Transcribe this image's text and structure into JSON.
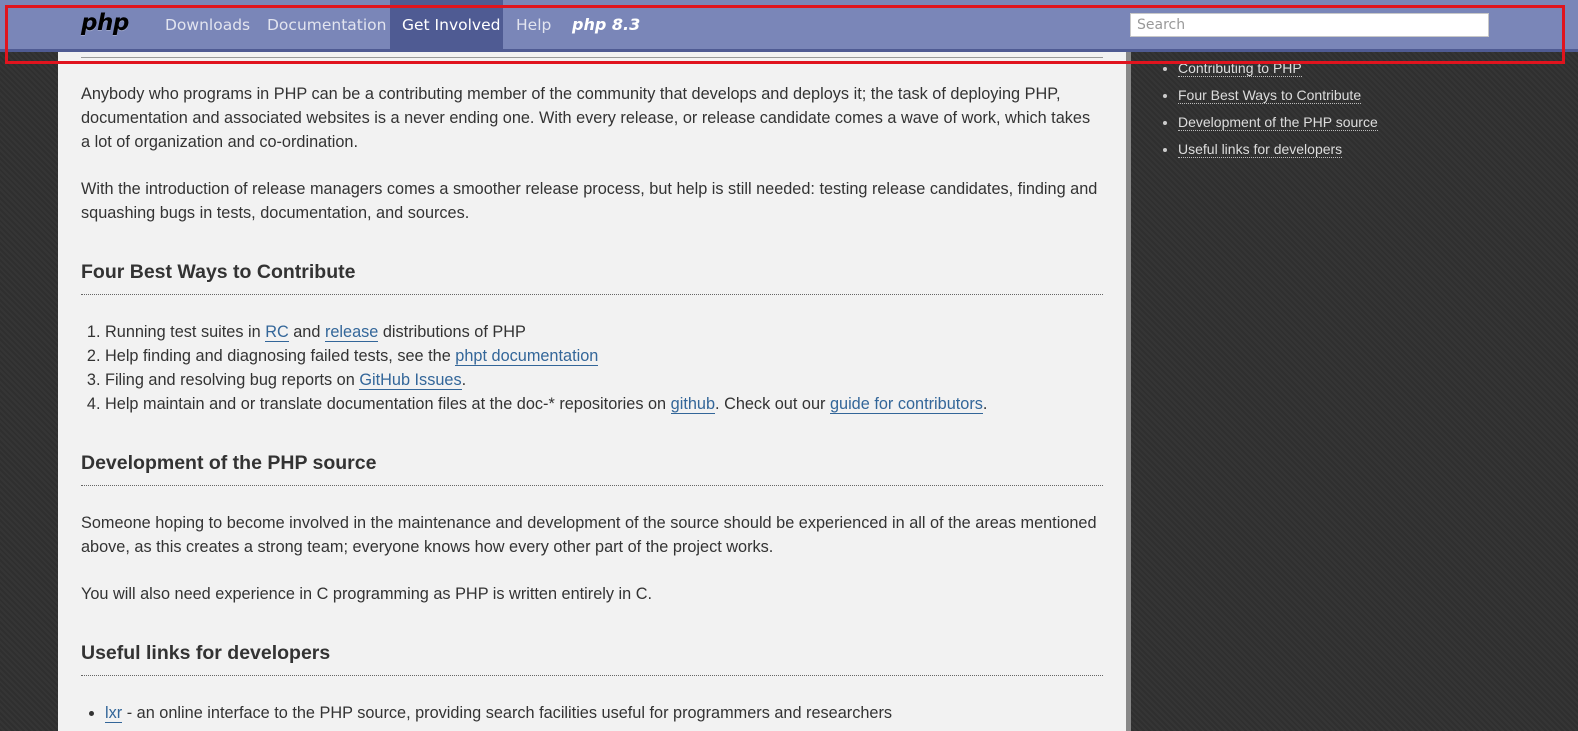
{
  "navbar": {
    "logo": "php",
    "items": [
      "Downloads",
      "Documentation",
      "Get Involved",
      "Help"
    ],
    "active_item": "Get Involved",
    "release_badge": "php 8.3",
    "search_placeholder": "Search"
  },
  "main": {
    "intro_paragraphs": [
      "Anybody who programs in PHP can be a contributing member of the community that develops and deploys it; the task of deploying PHP, documentation and associated websites is a never ending one. With every release, or release candidate comes a wave of work, which takes a lot of organization and co-ordination.",
      "With the introduction of release managers comes a smoother release process, but help is still needed: testing release candidates, finding and squashing bugs in tests, documentation, and sources."
    ],
    "sections": [
      {
        "heading": "Four Best Ways to Contribute",
        "list": [
          {
            "text_before": "Running test suites in ",
            "link1": "RC",
            "text_middle": " and ",
            "link2": "release",
            "text_after": " distributions of PHP"
          },
          {
            "text_before": "Help finding and diagnosing failed tests, see the ",
            "link1": "phpt documentation",
            "text_after": ""
          },
          {
            "text_before": "Filing and resolving bug reports on ",
            "link1": "GitHub Issues",
            "text_after": "."
          },
          {
            "text_before": "Help maintain and or translate documentation files at the doc-* repositories on ",
            "link1": "github",
            "text_middle": ". Check out our ",
            "link2": "guide for contributors",
            "text_after": "."
          }
        ]
      },
      {
        "heading": "Development of the PHP source",
        "paragraphs": [
          "Someone hoping to become involved in the maintenance and development of the source should be experienced in all of the areas mentioned above, as this creates a strong team; everyone knows how every other part of the project works.",
          "You will also need experience in C programming as PHP is written entirely in C."
        ]
      },
      {
        "heading": "Useful links for developers",
        "list": [
          {
            "link": "lxr",
            "text": " - an online interface to the PHP source, providing search facilities useful for programmers and researchers"
          }
        ]
      }
    ]
  },
  "sidebar": {
    "items": [
      "Contributing to PHP",
      "Four Best Ways to Contribute",
      "Development of the PHP source",
      "Useful links for developers"
    ]
  },
  "colors": {
    "navbar_bg": "#7a86b8",
    "navbar_active": "#4f5b93",
    "link": "#336699",
    "highlight": "#e0141e"
  }
}
